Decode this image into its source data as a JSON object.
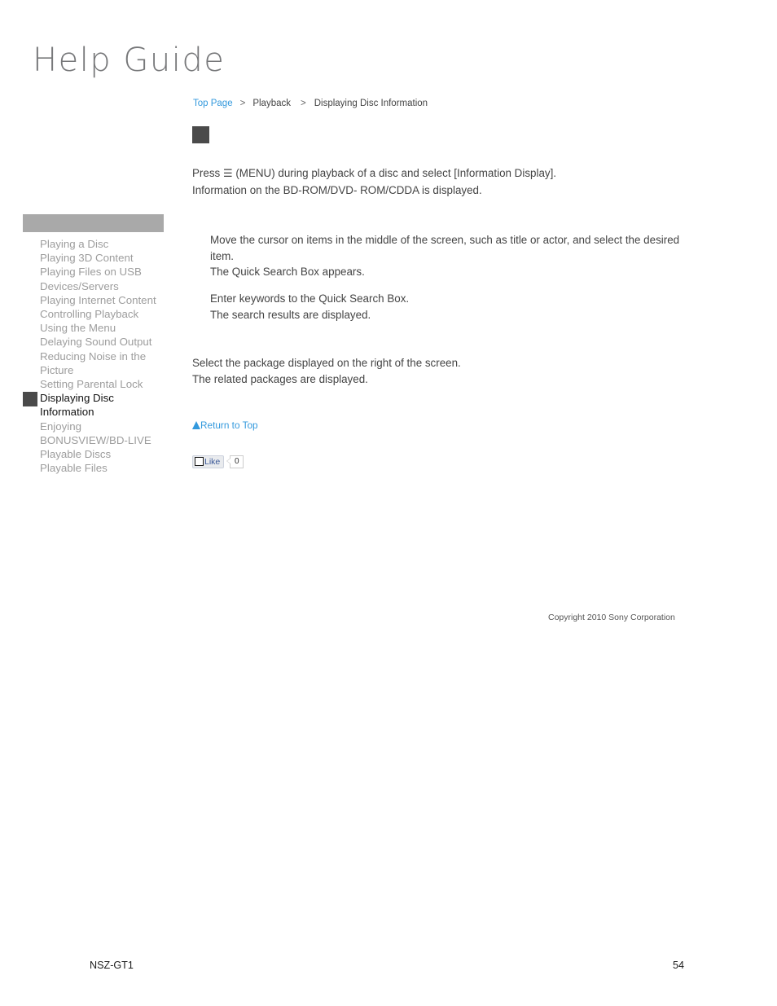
{
  "logo": {
    "text": "Help Guide"
  },
  "breadcrumb": {
    "top_page": "Top Page",
    "separator_1": ">",
    "section": "Playback",
    "separator_2": ">",
    "current": "Displaying Disc Information"
  },
  "sidebar": {
    "header_label": "",
    "items": [
      {
        "label": "Playing a Disc",
        "active": false
      },
      {
        "label": "Playing 3D Content",
        "active": false
      },
      {
        "label": "Playing Files on USB Devices/Servers",
        "active": false
      },
      {
        "label": "Playing Internet Content",
        "active": false
      },
      {
        "label": "Controlling Playback Using the Menu",
        "active": false
      },
      {
        "label": "Delaying Sound Output",
        "active": false
      },
      {
        "label": "Reducing Noise in the Picture",
        "active": false
      },
      {
        "label": "Setting Parental Lock",
        "active": false
      },
      {
        "label": "Displaying Disc Information",
        "active": true
      },
      {
        "label": "Enjoying BONUSVIEW/BD-LIVE",
        "active": false
      },
      {
        "label": "Playable Discs",
        "active": false
      },
      {
        "label": "Playable Files",
        "active": false
      }
    ]
  },
  "content": {
    "intro_line_1_before": "Press ",
    "intro_menu_glyph": "☰",
    "intro_line_1_after": " (MENU) during playback of a disc and select [Information Display].",
    "intro_line_2": "Information on the BD-ROM/DVD- ROM/CDDA is displayed.",
    "indent_line_1": "Move the cursor on items in the middle of the screen, such as title or actor, and select the desired item.",
    "indent_line_2": "The Quick Search Box appears.",
    "indent_line_3": "Enter keywords to the Quick Search Box.",
    "indent_line_4": "The search results are displayed.",
    "lower_line_1": "Select the package displayed on the right of the screen.",
    "lower_line_2": "The related packages are displayed."
  },
  "return_to_top": {
    "label": "Return to Top"
  },
  "like_widget": {
    "label": "Like",
    "count": "0"
  },
  "copyright": {
    "text": "Copyright 2010 Sony Corporation"
  },
  "footer": {
    "model": "NSZ-GT1",
    "page_number": "54"
  },
  "colors": {
    "link_blue": "#3399dd",
    "body_text": "#444444",
    "sidebar_item": "#9d9d9d",
    "sidebar_header_bg": "#a9a9a9",
    "marker_gray": "#4a4a4a",
    "like_blue": "#3b5998"
  }
}
